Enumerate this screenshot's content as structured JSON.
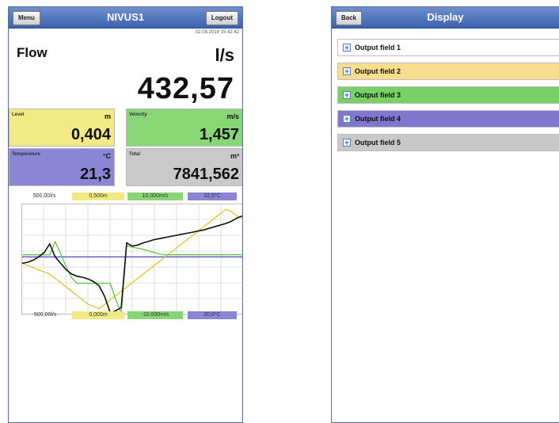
{
  "left_screen": {
    "title": "NIVUS1",
    "menu_label": "Menu",
    "logout_label": "Logout",
    "datetime": "02.08.2018 15:42:42",
    "flow": {
      "label": "Flow",
      "unit": "l/s",
      "value": "432,57"
    },
    "tiles": [
      {
        "label": "Level",
        "unit": "m",
        "value": "0,404",
        "color": "#f2ea84"
      },
      {
        "label": "Velocity",
        "unit": "m/s",
        "value": "1,457",
        "color": "#88d676"
      },
      {
        "label": "Temperature",
        "unit": "°C",
        "value": "21,3",
        "color": "#8b85d6"
      },
      {
        "label": "Total",
        "unit": "m³",
        "value": "7841,562",
        "color": "#c9c9c9"
      }
    ],
    "chart_top_scales": [
      "500,00l/s",
      "0,500m",
      "10,000m/s",
      "22,5°C"
    ],
    "chart_bottom_scales": [
      "-500,00l/s",
      "0,000m",
      "-10,000m/s",
      "20,0°C"
    ],
    "chart_data": {
      "type": "line",
      "xlabel": "",
      "ylabel": "",
      "x": [
        0,
        1,
        2,
        3,
        4,
        5,
        6,
        7,
        8,
        9,
        10,
        11,
        12,
        13,
        14,
        15,
        16,
        17,
        18,
        19,
        20,
        21,
        22,
        23,
        24,
        25,
        26,
        27,
        28,
        29,
        30,
        31,
        32,
        33,
        34,
        35,
        36,
        37,
        38,
        39,
        40
      ],
      "series": [
        {
          "name": "l/s",
          "color": "#111111",
          "ylim": [
            -500,
            500
          ],
          "values": [
            -40,
            -30,
            -10,
            20,
            60,
            140,
            20,
            -40,
            -100,
            -140,
            -160,
            -170,
            -185,
            -210,
            -250,
            -350,
            -500,
            -480,
            -450,
            150,
            120,
            130,
            150,
            165,
            180,
            190,
            200,
            210,
            220,
            230,
            240,
            250,
            260,
            270,
            285,
            300,
            315,
            330,
            350,
            380,
            400
          ]
        },
        {
          "name": "m",
          "color": "#e6c22a",
          "ylim": [
            0,
            0.5
          ],
          "values": [
            0.23,
            0.22,
            0.21,
            0.2,
            0.19,
            0.18,
            0.16,
            0.14,
            0.12,
            0.1,
            0.08,
            0.06,
            0.04,
            0.03,
            0.02,
            0.04,
            0.06,
            0.08,
            0.1,
            0.12,
            0.14,
            0.16,
            0.18,
            0.2,
            0.22,
            0.24,
            0.26,
            0.28,
            0.3,
            0.32,
            0.34,
            0.36,
            0.38,
            0.4,
            0.42,
            0.44,
            0.46,
            0.48,
            0.47,
            0.45,
            0.44
          ]
        },
        {
          "name": "m/s",
          "color": "#5ec646",
          "ylim": [
            -10,
            10
          ],
          "values": [
            0.8,
            0.8,
            0.8,
            0.8,
            0.8,
            0.8,
            3.2,
            1.0,
            -1.5,
            -3.5,
            -4.5,
            -4.5,
            -4.5,
            -4.5,
            -4.5,
            -4.5,
            -4.5,
            -7.5,
            -10,
            2.5,
            2.2,
            2.0,
            1.8,
            1.5,
            1.2,
            0.9,
            0.8,
            0.8,
            0.8,
            0.8,
            0.8,
            0.8,
            0.8,
            0.8,
            0.8,
            0.8,
            0.8,
            0.8,
            0.8,
            0.8,
            0.8
          ]
        },
        {
          "name": "°C",
          "color": "#5a55c8",
          "ylim": [
            20,
            22.5
          ],
          "values": [
            21.3,
            21.3,
            21.3,
            21.3,
            21.3,
            21.3,
            21.3,
            21.3,
            21.3,
            21.3,
            21.3,
            21.3,
            21.3,
            21.3,
            21.3,
            21.3,
            21.3,
            21.3,
            21.3,
            21.3,
            21.3,
            21.3,
            21.3,
            21.3,
            21.3,
            21.3,
            21.3,
            21.3,
            21.3,
            21.3,
            21.3,
            21.3,
            21.3,
            21.3,
            21.3,
            21.3,
            21.3,
            21.3,
            21.3,
            21.3,
            21.3
          ]
        }
      ],
      "grid": true
    }
  },
  "right_screen": {
    "title": "Display",
    "back_label": "Back",
    "fields": [
      {
        "label": "Output field 1",
        "color": "#ffffff"
      },
      {
        "label": "Output field 2",
        "color": "#f8dd8e"
      },
      {
        "label": "Output field 3",
        "color": "#79d067"
      },
      {
        "label": "Output field 4",
        "color": "#8177cf"
      },
      {
        "label": "Output field 5",
        "color": "#c8c8c8"
      }
    ]
  }
}
